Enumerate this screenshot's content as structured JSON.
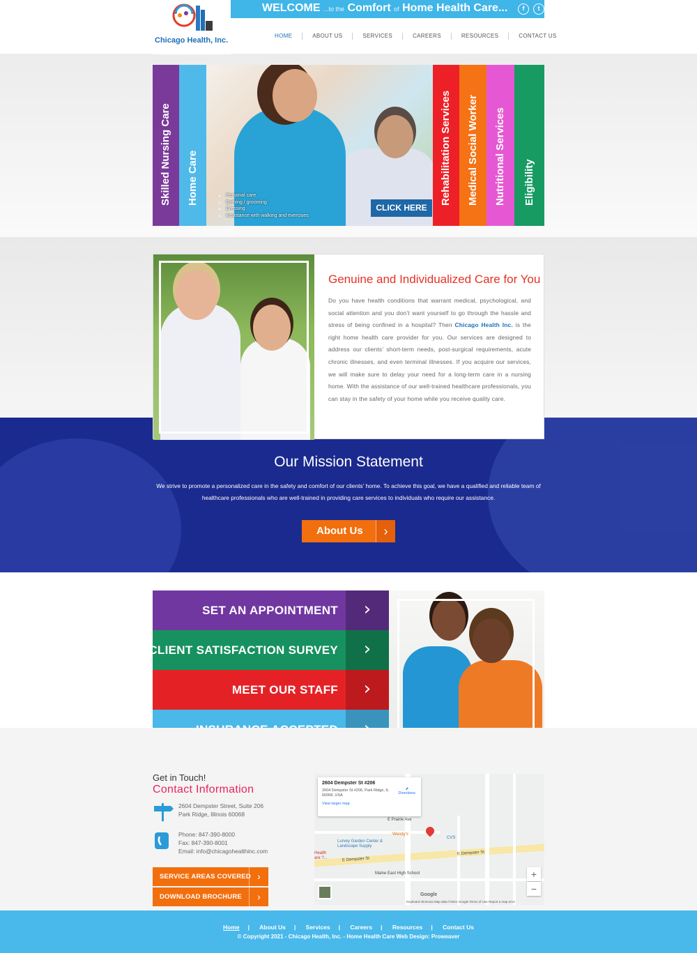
{
  "topbar": {
    "welcome_1": "WELCOME",
    "welcome_2": "...to the",
    "welcome_3": "Comfort",
    "welcome_4": "of",
    "welcome_5": "Home Health Care...",
    "facebook_glyph": "f",
    "twitter_glyph": "t"
  },
  "header": {
    "logo_text": "Chicago Health, Inc.",
    "nav": [
      "HOME",
      "ABOUT US",
      "SERVICES",
      "CAREERS",
      "RESOURCES",
      "CONTACT US"
    ]
  },
  "hero": {
    "tabs_left": [
      {
        "label": "Skilled Nursing Care",
        "color": "#7a3a9a"
      },
      {
        "label": "Home Care",
        "color": "#4fb9ea"
      }
    ],
    "tabs_right": [
      {
        "label": "Rehabilitation Services",
        "color": "#ee2027"
      },
      {
        "label": "Medical Social Worker",
        "color": "#f57215"
      },
      {
        "label": "Nutritional Services",
        "color": "#e658d3"
      },
      {
        "label": "Eligibility",
        "color": "#179b63"
      }
    ],
    "bullets": [
      "Personal care",
      "Bathing / grooming",
      "Dressing",
      "Assistance with walking and exercises"
    ],
    "click_label": "CLICK HERE"
  },
  "care": {
    "title": "Genuine and Individualized Care for You",
    "text_before": "Do you have health conditions that warrant medical, psychological, and social attention and you don’t want yourself to go through the hassle and stress of being confined in a hospital? Then ",
    "text_brand": "Chicago Health Inc.",
    "text_after": " is the right home health care provider for you. Our services are designed to address our clients’ short-term needs, post-surgical requirements, acute chronic illnesses, and even terminal illnesses. If you acquire our services, we will make sure to delay your need for a long-term care in a nursing home. With the assistance of our well-trained healthcare professionals, you can stay in the safety of your home while you receive quality care."
  },
  "mission": {
    "title": "Our Mission Statement",
    "text": "We strive to promote a personalized care in the safety and comfort of our clients’ home. To achieve this goal, we have a qualified and reliable team of healthcare professionals who are well-trained in providing care services to individuals who require our assistance.",
    "button": "About Us"
  },
  "services": [
    {
      "label": "SET AN APPOINTMENT",
      "color": "#7137a0",
      "arrow_color": "#532a79"
    },
    {
      "label": "CLIENT SATISFACTION SURVEY",
      "color": "#17915f",
      "arrow_color": "#107048"
    },
    {
      "label": "MEET OUR STAFF",
      "color": "#e42226",
      "arrow_color": "#bd1a1d"
    },
    {
      "label": "INSURANCE ACCEPTED",
      "color": "#4ab8e8",
      "arrow_color": "#3a93bd"
    }
  ],
  "contact": {
    "get_in_touch": "Get in Touch!",
    "title": "Contact Information",
    "address_1": "2604 Dempster Street, Suite 206",
    "address_2": "Park Ridge, Illinois 60068",
    "phone": "Phone: 847-390-8000",
    "fax": "Fax: 847-390-8001",
    "email": "Email: info@chicagohealthinc.com",
    "btn_service_areas": "SERVICE AREAS COVERED",
    "btn_brochure": "DOWNLOAD BROCHURE"
  },
  "map": {
    "popup_title": "2604 Dempster St #206",
    "popup_address": "2604 Dempster St #206, Park Ridge, IL 60068, USA",
    "directions": "Directions",
    "view_larger": "View larger map",
    "street_main": "E Dempster St",
    "street_main_2": "E Dempster St",
    "school": "Maine East High School",
    "garden": "Lurvey Garden Center & Landscape Supply",
    "wendys": "Wendy's",
    "cvs": "CVS",
    "health": "Health are ?...",
    "prairie": "E Prairie Ave",
    "attribution": "Keyboard shortcuts   Map data ©2021 Google   Terms of Use   Report a map error",
    "google": "Google",
    "zoom_in": "+",
    "zoom_out": "−"
  },
  "footer": {
    "links": [
      "Home",
      "About Us",
      "Services",
      "Careers",
      "Resources",
      "Contact Us"
    ],
    "copyright": "© Copyright 2021 - Chicago Health, Inc. - Home Health Care Web Design: Proweaver"
  }
}
